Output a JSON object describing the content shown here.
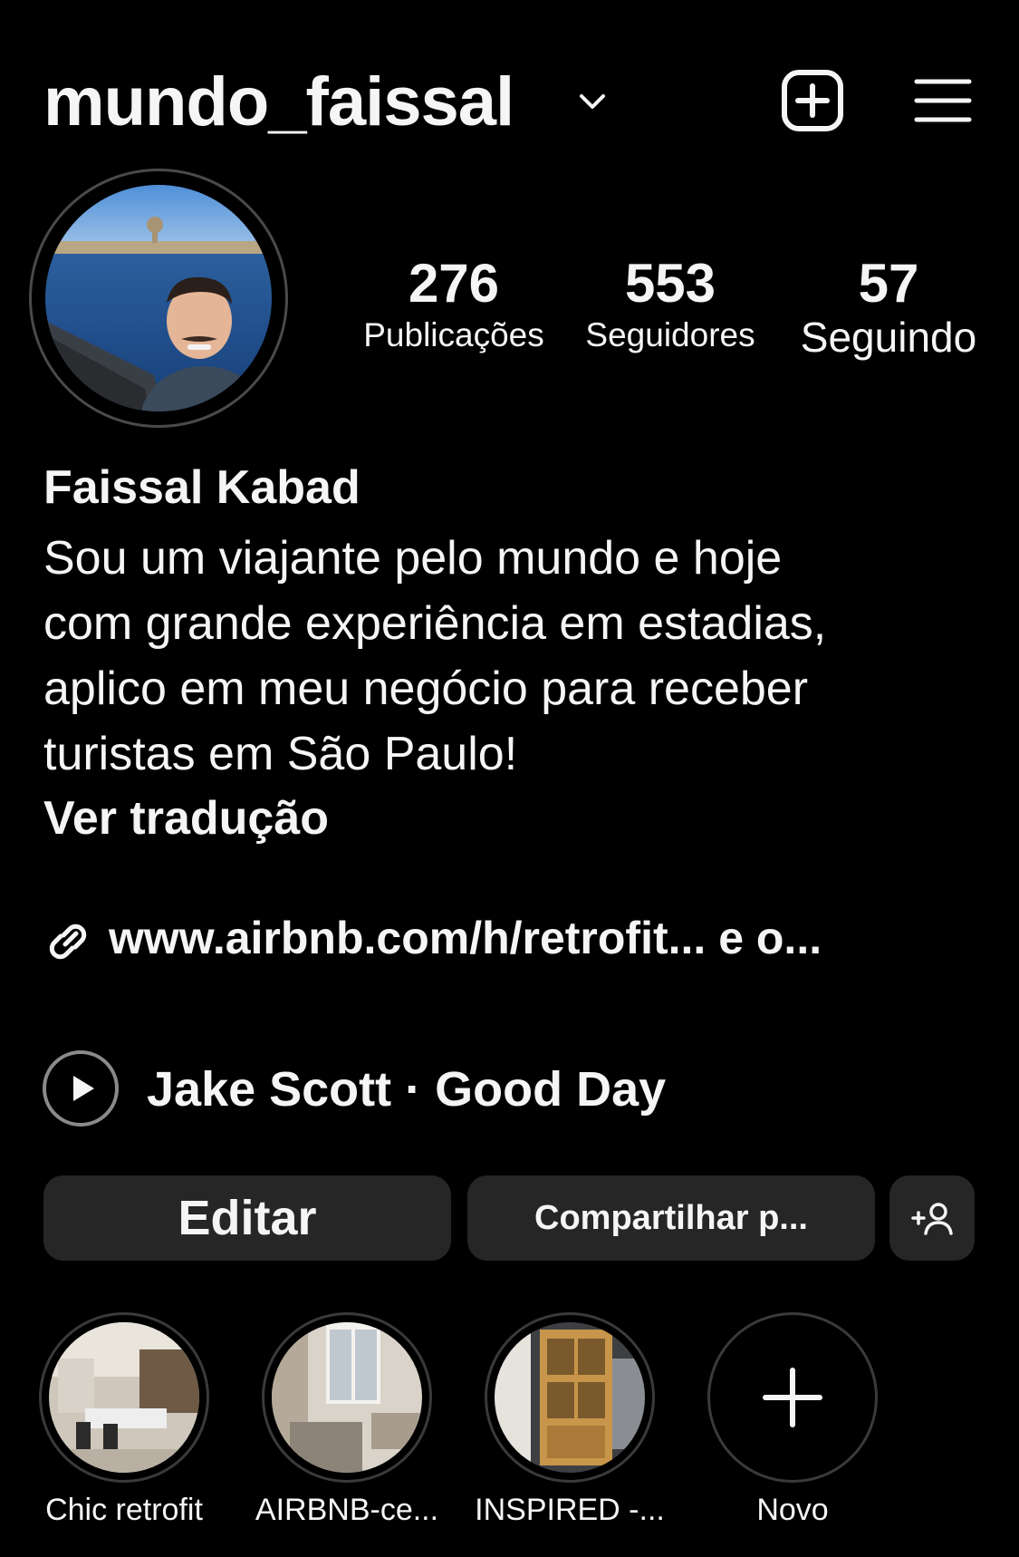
{
  "header": {
    "username": "mundo_faissal",
    "icons": [
      "chevron-down-icon",
      "add-square-icon",
      "hamburger-menu-icon"
    ]
  },
  "stats": [
    {
      "value": "276",
      "label": "Publicações"
    },
    {
      "value": "553",
      "label": "Seguidores"
    },
    {
      "value": "57",
      "label": "Seguindo"
    }
  ],
  "profile": {
    "name": "Faissal Kabad",
    "bio_lines": [
      "Sou um viajante pelo mundo e hoje",
      "com grande experiência em estadias,",
      "aplico em meu negócio para receber",
      "turistas em São Paulo!"
    ],
    "translate_label": "Ver tradução",
    "link_text": "www.airbnb.com/h/retrofit...  e o...",
    "music": "Jake Scott · Good Day"
  },
  "actions": {
    "edit_label": "Editar",
    "share_label": "Compartilhar p...",
    "discover_icon": "add-person-icon"
  },
  "highlights": [
    {
      "label": "Chic retrofit"
    },
    {
      "label": "AIRBNB-ce..."
    },
    {
      "label": "INSPIRED -..."
    },
    {
      "label": "Novo",
      "icon": "plus-icon"
    }
  ],
  "colors": {
    "background": "#000000",
    "text": "#f5f5f5",
    "button_bg": "#262626",
    "ring": "#4a4a4a"
  }
}
